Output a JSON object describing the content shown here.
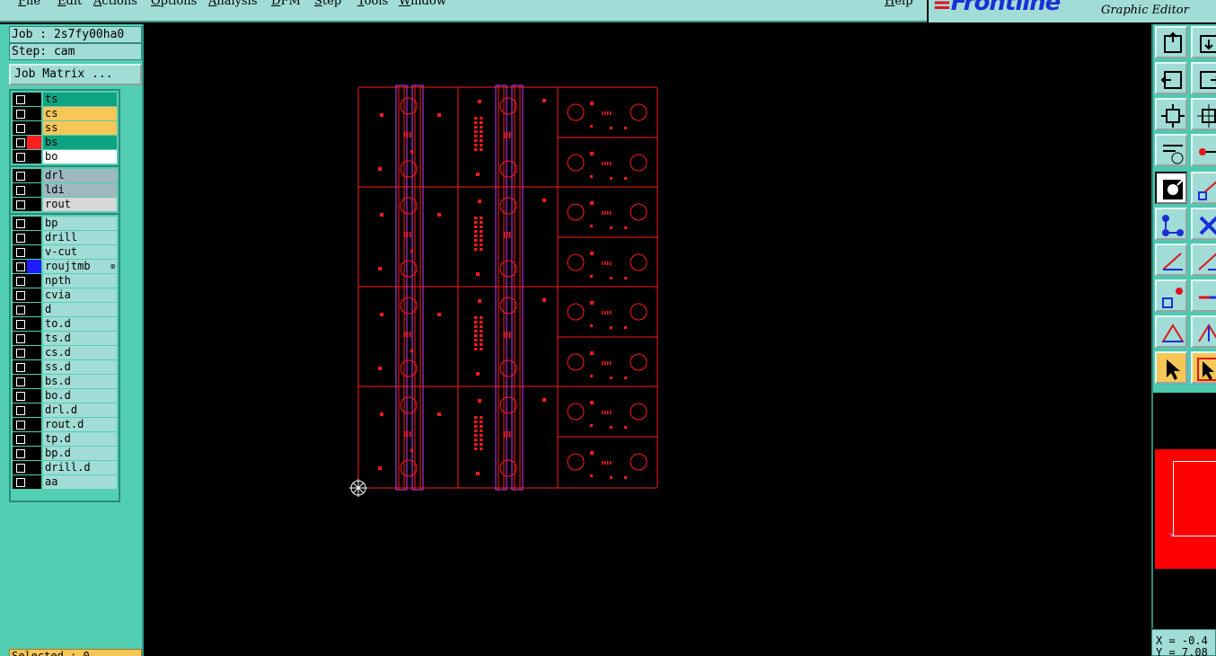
{
  "menu": {
    "items": [
      "File",
      "Edit",
      "Actions",
      "Options",
      "Analysis",
      "DFM",
      "Step",
      "Tools",
      "Window"
    ],
    "help": "Help"
  },
  "brand": {
    "logo": "Frontline",
    "subtitle": "Graphic Editor"
  },
  "job": {
    "label": "Job : 2s7fy00ha0",
    "step": "Step: cam",
    "matrix_button": "Job Matrix ..."
  },
  "layers": [
    {
      "name": "ts",
      "bg": "#0fa481",
      "sw": "#000000"
    },
    {
      "name": "cs",
      "bg": "#f6c757",
      "sw": "#000000"
    },
    {
      "name": "ss",
      "bg": "#f6c757",
      "sw": "#000000"
    },
    {
      "name": "bs",
      "bg": "#0fa481",
      "sw": "#ff1f1f"
    },
    {
      "name": "bo",
      "bg": "#ffffff",
      "sw": "#000000"
    },
    {
      "name": "drl",
      "bg": "#9fb8bf",
      "sw": "#000000"
    },
    {
      "name": "ldi",
      "bg": "#9fb8bf",
      "sw": "#000000"
    },
    {
      "name": "rout",
      "bg": "#d8d8d8",
      "sw": "#000000"
    },
    {
      "name": "bp",
      "bg": "#a2dcd6",
      "sw": "#000000"
    },
    {
      "name": "drill",
      "bg": "#a2dcd6",
      "sw": "#000000"
    },
    {
      "name": "v-cut",
      "bg": "#a2dcd6",
      "sw": "#000000"
    },
    {
      "name": "roujtmb",
      "bg": "#a2dcd6",
      "sw": "#1c1cff",
      "mark": "⊞"
    },
    {
      "name": "npth",
      "bg": "#a2dcd6",
      "sw": "#000000"
    },
    {
      "name": "cvia",
      "bg": "#a2dcd6",
      "sw": "#000000"
    },
    {
      "name": "d",
      "bg": "#a2dcd6",
      "sw": "#000000"
    },
    {
      "name": "to.d",
      "bg": "#a2dcd6",
      "sw": "#000000"
    },
    {
      "name": "ts.d",
      "bg": "#a2dcd6",
      "sw": "#000000"
    },
    {
      "name": "cs.d",
      "bg": "#a2dcd6",
      "sw": "#000000"
    },
    {
      "name": "ss.d",
      "bg": "#a2dcd6",
      "sw": "#000000"
    },
    {
      "name": "bs.d",
      "bg": "#a2dcd6",
      "sw": "#000000"
    },
    {
      "name": "bo.d",
      "bg": "#a2dcd6",
      "sw": "#000000"
    },
    {
      "name": "drl.d",
      "bg": "#a2dcd6",
      "sw": "#000000"
    },
    {
      "name": "rout.d",
      "bg": "#a2dcd6",
      "sw": "#000000"
    },
    {
      "name": "tp.d",
      "bg": "#a2dcd6",
      "sw": "#000000"
    },
    {
      "name": "bp.d",
      "bg": "#a2dcd6",
      "sw": "#000000"
    },
    {
      "name": "drill.d",
      "bg": "#a2dcd6",
      "sw": "#000000"
    },
    {
      "name": "aa",
      "bg": "#a2dcd6",
      "sw": "#000000"
    }
  ],
  "selected": "Selected : 0",
  "coords": {
    "x": "X = -0.4",
    "y": "Y = 7.08"
  },
  "colors": {
    "board": "#ff1a1a",
    "rail": "#c83cff",
    "preview": "#ff0000"
  },
  "icons": [
    "export-icon",
    "import-icon",
    "pan-left-icon",
    "pan-right-icon",
    "zoom-fit-icon",
    "zoom-center-icon",
    "snap-settings-icon",
    "connect-icon",
    "draw-select-icon",
    "draw-line-icon",
    "node-move-icon",
    "cross-icon",
    "angle-icon",
    "angle-alt-icon",
    "snap-node-icon",
    "line-icon",
    "triangle-icon",
    "arrow-triangle-icon",
    "pointer-icon",
    "pointer-box-icon"
  ]
}
